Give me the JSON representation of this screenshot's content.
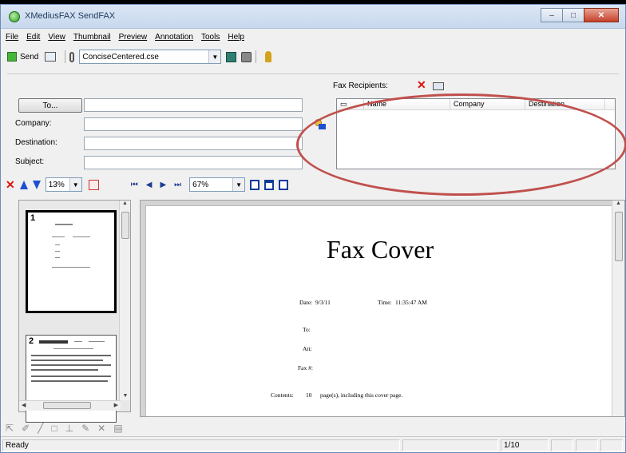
{
  "window": {
    "title": "XMediusFAX SendFAX",
    "controls": [
      "–",
      "□",
      "✕"
    ]
  },
  "menu": [
    "File",
    "Edit",
    "View",
    "Thumbnail",
    "Preview",
    "Annotation",
    "Tools",
    "Help"
  ],
  "toolbar": {
    "send_label": "Send",
    "cover_template": "ConciseCentered.cse"
  },
  "form": {
    "to_button": "To...",
    "company_label": "Company:",
    "destination_label": "Destination:",
    "subject_label": "Subject:",
    "recipients_label": "Fax Recipients:",
    "recipients_columns": [
      "Name",
      "Company",
      "Destination"
    ]
  },
  "thumb_toolbar": {
    "zoom": "13%"
  },
  "preview_toolbar": {
    "nav": [
      "⏮",
      "◀",
      "▶",
      "⏭"
    ],
    "zoom": "67%"
  },
  "thumbnails": [
    {
      "number": "1",
      "selected": true
    },
    {
      "number": "2",
      "selected": false
    }
  ],
  "preview_page": {
    "title": "Fax Cover",
    "date_label": "Date:",
    "date_value": "9/3/11",
    "time_label": "Time:",
    "time_value": "11:35:47 AM",
    "to_label": "To:",
    "att_label": "Att:",
    "fax_label": "Fax #:",
    "contents_label": "Contents:",
    "contents_value": "10",
    "contents_suffix": "page(s), including this cover page."
  },
  "status": {
    "text": "Ready",
    "page_count": "1/10"
  },
  "colors": {
    "annotation_oval": "#c0504d",
    "delete_x": "#e01010",
    "nav_arrows": "#1f4fd1"
  }
}
